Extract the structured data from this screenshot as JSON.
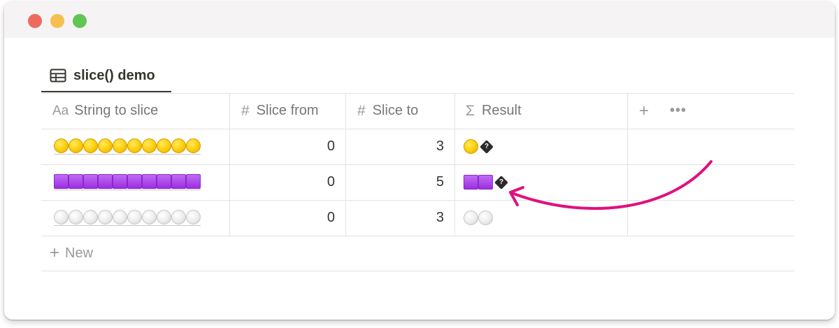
{
  "window": {
    "traffic_lights": [
      "close",
      "minimize",
      "zoom"
    ]
  },
  "tab": {
    "label": "slice() demo",
    "icon": "table-icon"
  },
  "columns": [
    {
      "icon_text": "Aa",
      "label": "String to slice",
      "icon": "title-property-icon"
    },
    {
      "icon_text": "#",
      "label": "Slice from",
      "icon": "number-property-icon"
    },
    {
      "icon_text": "#",
      "label": "Slice to",
      "icon": "number-property-icon"
    },
    {
      "icon_text": "Σ",
      "label": "Result",
      "icon": "formula-property-icon"
    }
  ],
  "add_column": {
    "plus": "+",
    "more": "•••"
  },
  "rows": [
    {
      "string_emoji": "yellow-circle",
      "string_count": 10,
      "slice_from": "0",
      "slice_to": "3",
      "result_emoji": "yellow-circle",
      "result_count": 1,
      "result_broken": true
    },
    {
      "string_emoji": "purple-square",
      "string_count": 10,
      "slice_from": "0",
      "slice_to": "5",
      "result_emoji": "purple-square",
      "result_count": 2,
      "result_broken": true
    },
    {
      "string_emoji": "white-circle",
      "string_count": 10,
      "slice_from": "0",
      "slice_to": "3",
      "result_emoji": "white-circle",
      "result_count": 2,
      "result_broken": false
    }
  ],
  "new_row": {
    "plus": "+",
    "label": "New"
  },
  "broken_glyph": "?",
  "colors": {
    "arrow": "#e0107f",
    "text": "#37352f",
    "muted": "#787774",
    "border": "#e3e2e0"
  }
}
